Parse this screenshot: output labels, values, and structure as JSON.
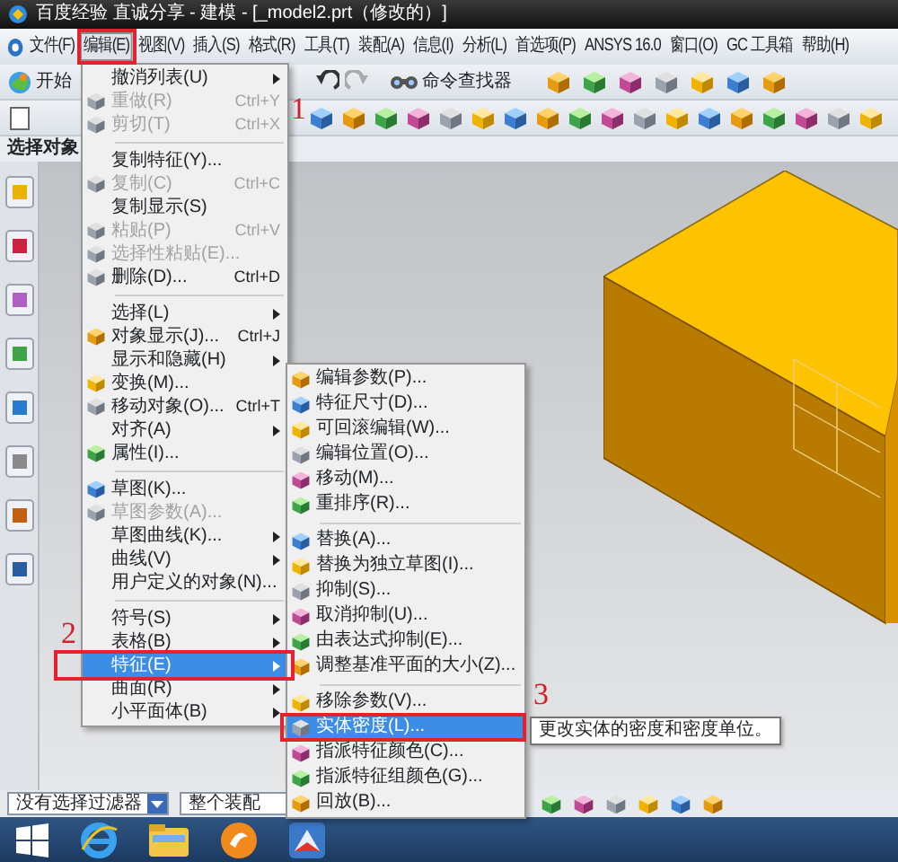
{
  "window": {
    "title": "百度经验  直诚分享 - 建模 - [_model2.prt（修改的）]"
  },
  "menu_bar": [
    {
      "label": "文件(F)",
      "selected": false
    },
    {
      "label": "编辑(E)",
      "selected": true
    },
    {
      "label": "视图(V)",
      "selected": false
    },
    {
      "label": "插入(S)",
      "selected": false
    },
    {
      "label": "格式(R)",
      "selected": false
    },
    {
      "label": "工具(T)",
      "selected": false
    },
    {
      "label": "装配(A)",
      "selected": false
    },
    {
      "label": "信息(I)",
      "selected": false
    },
    {
      "label": "分析(L)",
      "selected": false
    },
    {
      "label": "首选项(P)",
      "selected": false
    },
    {
      "label": "ANSYS 16.0",
      "selected": false
    },
    {
      "label": "窗口(O)",
      "selected": false
    },
    {
      "label": "GC 工具箱",
      "selected": false
    },
    {
      "label": "帮助(H)",
      "selected": false
    }
  ],
  "toolbar": {
    "start_label": "开始",
    "command_finder_label": "命令查找器"
  },
  "selection_bar": {
    "prompt": "选择对象"
  },
  "edit_menu": {
    "items": [
      {
        "kind": "item",
        "label": "撤消列表(U)",
        "submenu": true,
        "disabled": false,
        "selected": false
      },
      {
        "kind": "item",
        "label": "重做(R)",
        "shortcut": "Ctrl+Y",
        "icon": true,
        "disabled": true,
        "selected": false
      },
      {
        "kind": "item",
        "label": "剪切(T)",
        "shortcut": "Ctrl+X",
        "icon": true,
        "disabled": true,
        "selected": false
      },
      {
        "kind": "separator"
      },
      {
        "kind": "item",
        "label": "复制特征(Y)...",
        "disabled": false,
        "selected": false
      },
      {
        "kind": "item",
        "label": "复制(C)",
        "shortcut": "Ctrl+C",
        "icon": true,
        "disabled": true,
        "selected": false
      },
      {
        "kind": "item",
        "label": "复制显示(S)",
        "disabled": false,
        "selected": false
      },
      {
        "kind": "item",
        "label": "粘贴(P)",
        "shortcut": "Ctrl+V",
        "icon": true,
        "disabled": true,
        "selected": false
      },
      {
        "kind": "item",
        "label": "选择性粘贴(E)...",
        "icon": true,
        "disabled": true,
        "selected": false
      },
      {
        "kind": "item",
        "label": "删除(D)...",
        "shortcut": "Ctrl+D",
        "icon": true,
        "disabled": false,
        "selected": false
      },
      {
        "kind": "separator"
      },
      {
        "kind": "item",
        "label": "选择(L)",
        "submenu": true,
        "disabled": false,
        "selected": false
      },
      {
        "kind": "item",
        "label": "对象显示(J)...",
        "shortcut": "Ctrl+J",
        "icon": true,
        "disabled": false,
        "selected": false
      },
      {
        "kind": "item",
        "label": "显示和隐藏(H)",
        "submenu": true,
        "disabled": false,
        "selected": false
      },
      {
        "kind": "item",
        "label": "变换(M)...",
        "icon": true,
        "disabled": false,
        "selected": false
      },
      {
        "kind": "item",
        "label": "移动对象(O)...",
        "shortcut": "Ctrl+T",
        "icon": true,
        "disabled": false,
        "selected": false
      },
      {
        "kind": "item",
        "label": "对齐(A)",
        "submenu": true,
        "disabled": false,
        "selected": false
      },
      {
        "kind": "item",
        "label": "属性(I)...",
        "icon": true,
        "disabled": false,
        "selected": false
      },
      {
        "kind": "separator"
      },
      {
        "kind": "item",
        "label": "草图(K)...",
        "icon": true,
        "disabled": false,
        "selected": false
      },
      {
        "kind": "item",
        "label": "草图参数(A)...",
        "icon": true,
        "disabled": true,
        "selected": false
      },
      {
        "kind": "item",
        "label": "草图曲线(K)...",
        "submenu": true,
        "disabled": false,
        "selected": false
      },
      {
        "kind": "item",
        "label": "曲线(V)",
        "submenu": true,
        "disabled": false,
        "selected": false
      },
      {
        "kind": "item",
        "label": "用户定义的对象(N)...",
        "disabled": false,
        "selected": false
      },
      {
        "kind": "separator"
      },
      {
        "kind": "item",
        "label": "符号(S)",
        "submenu": true,
        "disabled": false,
        "selected": false
      },
      {
        "kind": "item",
        "label": "表格(B)",
        "submenu": true,
        "disabled": false,
        "selected": false
      },
      {
        "kind": "item",
        "label": "特征(E)",
        "submenu": true,
        "disabled": false,
        "selected": true
      },
      {
        "kind": "item",
        "label": "曲面(R)",
        "submenu": true,
        "disabled": false,
        "selected": false
      },
      {
        "kind": "item",
        "label": "小平面体(B)",
        "submenu": true,
        "disabled": false,
        "selected": false
      }
    ]
  },
  "feature_submenu": {
    "items": [
      {
        "kind": "item",
        "label": "编辑参数(P)...",
        "selected": false
      },
      {
        "kind": "item",
        "label": "特征尺寸(D)...",
        "selected": false
      },
      {
        "kind": "item",
        "label": "可回滚编辑(W)...",
        "selected": false
      },
      {
        "kind": "item",
        "label": "编辑位置(O)...",
        "selected": false
      },
      {
        "kind": "item",
        "label": "移动(M)...",
        "selected": false
      },
      {
        "kind": "item",
        "label": "重排序(R)...",
        "selected": false
      },
      {
        "kind": "separator"
      },
      {
        "kind": "item",
        "label": "替换(A)...",
        "selected": false
      },
      {
        "kind": "item",
        "label": "替换为独立草图(I)...",
        "selected": false
      },
      {
        "kind": "item",
        "label": "抑制(S)...",
        "selected": false
      },
      {
        "kind": "item",
        "label": "取消抑制(U)...",
        "selected": false
      },
      {
        "kind": "item",
        "label": "由表达式抑制(E)...",
        "selected": false
      },
      {
        "kind": "item",
        "label": "调整基准平面的大小(Z)...",
        "selected": false
      },
      {
        "kind": "separator"
      },
      {
        "kind": "item",
        "label": "移除参数(V)...",
        "selected": false
      },
      {
        "kind": "item",
        "label": "实体密度(L)...",
        "selected": true
      },
      {
        "kind": "item",
        "label": "指派特征颜色(C)...",
        "selected": false
      },
      {
        "kind": "item",
        "label": "指派特征组颜色(G)...",
        "selected": false
      },
      {
        "kind": "item",
        "label": "回放(B)...",
        "selected": false
      }
    ]
  },
  "tooltip": {
    "text": "更改实体的密度和密度单位。"
  },
  "filter_bar": {
    "type_filter": "没有选择过滤器",
    "scope": "整个装配"
  },
  "annotations": [
    {
      "number": "1"
    },
    {
      "number": "2"
    },
    {
      "number": "3"
    }
  ]
}
